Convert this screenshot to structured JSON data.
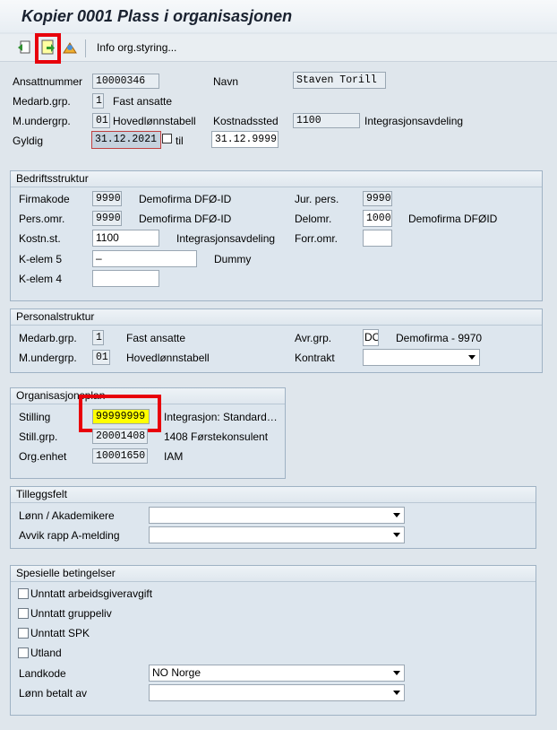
{
  "title": "Kopier 0001 Plass i organisasjonen",
  "toolbar": {
    "info_label": "Info org.styring..."
  },
  "header": {
    "ansattnummer_label": "Ansattnummer",
    "ansattnummer": "10000346",
    "navn_label": "Navn",
    "navn": "Staven Torill",
    "medarb_label": "Medarb.grp.",
    "medarb_code": "1",
    "medarb_text": "Fast ansatte",
    "munder_label": "M.undergrp.",
    "munder_code": "01",
    "munder_text": "Hovedlønnstabell",
    "kostnadssted_label": "Kostnadssted",
    "kostnadssted": "1100",
    "kostnadssted_text": "Integrasjonsavdeling",
    "gyldig_label": "Gyldig",
    "gyldig_from": "31.12.2021",
    "til_label": "til",
    "gyldig_to": "31.12.9999"
  },
  "bedrift": {
    "title": "Bedriftsstruktur",
    "firmakode_label": "Firmakode",
    "firmakode": "9990",
    "firmakode_text": "Demofirma DFØ-ID",
    "jurpers_label": "Jur. pers.",
    "jurpers": "9990",
    "persomr_label": "Pers.omr.",
    "persomr": "9990",
    "persomr_text": "Demofirma DFØ-ID",
    "delomr_label": "Delomr.",
    "delomr": "1000",
    "delomr_text": "Demofirma DFØID",
    "kostnst_label": "Kostn.st.",
    "kostnst": "1100",
    "kostnst_text": "Integrasjonsavdeling",
    "forromr_label": "Forr.omr.",
    "forromr": "",
    "kelem5_label": "K-elem 5",
    "kelem5": "–",
    "kelem5_text": "Dummy",
    "kelem4_label": "K-elem 4",
    "kelem4": ""
  },
  "personal": {
    "title": "Personalstruktur",
    "medarb_label": "Medarb.grp.",
    "medarb_code": "1",
    "medarb_text": "Fast ansatte",
    "avrgrp_label": "Avr.grp.",
    "avrgrp": "DO",
    "avrgrp_text": "Demofirma - 9970",
    "munder_label": "M.undergrp.",
    "munder_code": "01",
    "munder_text": "Hovedlønnstabell",
    "kontrakt_label": "Kontrakt",
    "kontrakt": ""
  },
  "org": {
    "title": "Organisasjonsplan",
    "stilling_label": "Stilling",
    "stilling": "99999999",
    "stilling_text": "Integrasjon: Standard…",
    "stillgrp_label": "Still.grp.",
    "stillgrp": "20001408",
    "stillgrp_text": "1408 Førstekonsulent",
    "orgenhet_label": "Org.enhet",
    "orgenhet": "10001650",
    "orgenhet_text": "IAM"
  },
  "tillegg": {
    "title": "Tilleggsfelt",
    "lonn_label": "Lønn / Akademikere",
    "lonn": "",
    "avvik_label": "Avvik rapp A-melding",
    "avvik": ""
  },
  "spesielle": {
    "title": "Spesielle betingelser",
    "cb1": "Unntatt arbeidsgiveravgift",
    "cb2": "Unntatt gruppeliv",
    "cb3": "Unntatt SPK",
    "cb4": "Utland",
    "landkode_label": "Landkode",
    "landkode": "NO Norge",
    "lonnbetalt_label": "Lønn betalt av",
    "lonnbetalt": ""
  },
  "icons": [
    "back-doc-icon",
    "copy-doc-icon",
    "org-structure-icon"
  ],
  "colors": {
    "highlight": "#ffff00",
    "red_marker": "#e8000b"
  }
}
